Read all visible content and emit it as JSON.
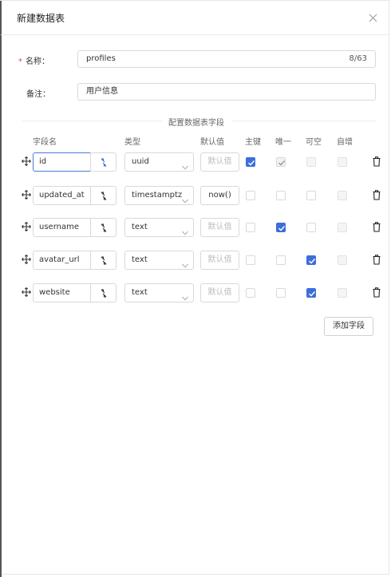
{
  "dialog": {
    "title": "新建数据表",
    "close_icon": "close-icon"
  },
  "form": {
    "name_label": "名称：",
    "name_required_mark": "*",
    "name_value": "profiles",
    "name_count": "8/63",
    "remark_label": "备注：",
    "remark_value": "用户信息"
  },
  "section_title": "配置数据表字段",
  "headers": {
    "field": "字段名",
    "type": "类型",
    "default": "默认值",
    "primary": "主键",
    "unique": "唯一",
    "nullable": "可空",
    "auto": "自增"
  },
  "rows": [
    {
      "name": "id",
      "type": "uuid",
      "default": "默认值",
      "default_is_placeholder": true,
      "primary": "on",
      "unique": "on-disabled",
      "nullable": "disabled",
      "auto": "disabled"
    },
    {
      "name": "updated_at",
      "type": "timestamptz",
      "default": "now()",
      "default_is_placeholder": false,
      "primary": "off",
      "unique": "off",
      "nullable": "off",
      "auto": "disabled"
    },
    {
      "name": "username",
      "type": "text",
      "default": "默认值",
      "default_is_placeholder": true,
      "primary": "off",
      "unique": "on",
      "nullable": "off",
      "auto": "disabled"
    },
    {
      "name": "avatar_url",
      "type": "text",
      "default": "默认值",
      "default_is_placeholder": true,
      "primary": "off",
      "unique": "off",
      "nullable": "on",
      "auto": "disabled"
    },
    {
      "name": "website",
      "type": "text",
      "default": "默认值",
      "default_is_placeholder": true,
      "primary": "off",
      "unique": "off",
      "nullable": "on",
      "auto": "disabled"
    }
  ],
  "add_field_label": "添加字段",
  "colors": {
    "accent": "#3d6fdb",
    "required": "#e34a4a",
    "border": "#d9d9d9"
  }
}
